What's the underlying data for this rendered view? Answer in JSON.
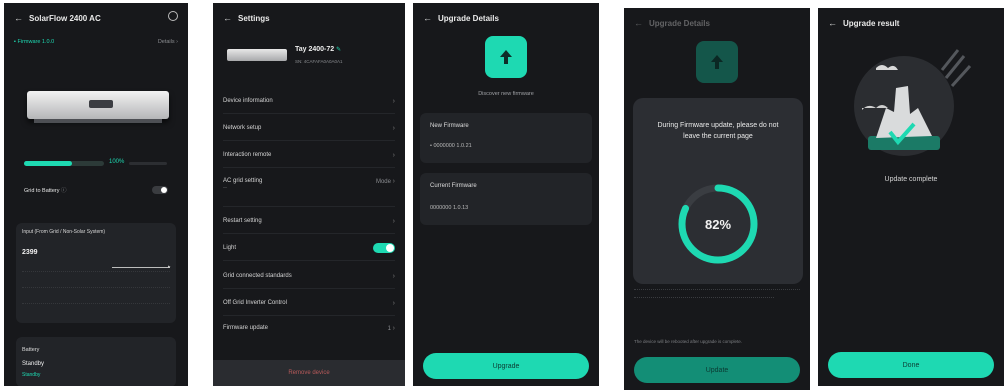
{
  "colors": {
    "accent": "#1ed9b2",
    "bg": "#17181b",
    "card": "#222428"
  },
  "s1": {
    "title": "SolarFlow 2400 AC",
    "firmware": "Firmware 1.0.0",
    "firmware_link": "Details",
    "battery_pct": "100%",
    "mode_label": "Grid to Battery",
    "section_title": "Input (From Grid / Non-Solar System)",
    "power_value": "2399",
    "bottom_label": "Battery",
    "bottom_value": "Standby",
    "bottom_status": "Standby",
    "icons": [
      "back-icon",
      "settings-icon",
      "info-icon"
    ]
  },
  "s2": {
    "title": "Settings",
    "device_name": "Tay 2400-72",
    "device_sn": "SN: 4CAFAFA0A0A0A1",
    "items": [
      {
        "label": "Device information",
        "value": ""
      },
      {
        "label": "Network setup",
        "value": ""
      },
      {
        "label": "Interaction remote",
        "value": ""
      },
      {
        "label": "AC grid setting",
        "value": "Mode"
      },
      {
        "label": "Restart setting",
        "value": ""
      },
      {
        "label": "Light",
        "value": ""
      },
      {
        "label": "Grid connected standards",
        "value": ""
      },
      {
        "label": "Off Grid Inverter Control",
        "value": ""
      },
      {
        "label": "Firmware update",
        "value": "1"
      }
    ],
    "remove_label": "Remove device"
  },
  "s3": {
    "title": "Upgrade Details",
    "subtitle": "Discover new firmware",
    "new_label": "New Firmware",
    "new_value": "• 0000000 1.0.21",
    "cur_label": "Current Firmware",
    "cur_value": "0000000 1.0.13",
    "button": "Upgrade"
  },
  "s4": {
    "title": "Upgrade Details",
    "warning": "During Firmware update, please do not leave the current page",
    "progress": 0.82,
    "progress_label": "82%",
    "note": "The device will be rebooted after upgrade is complete.",
    "button": "Update"
  },
  "s5": {
    "title": "Upgrade result",
    "status": "Update complete",
    "button": "Done"
  }
}
